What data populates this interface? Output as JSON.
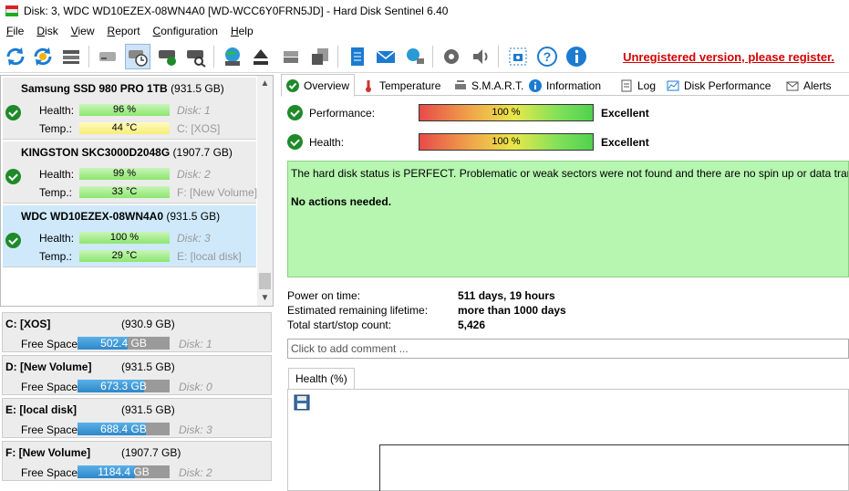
{
  "window": {
    "title": "Disk: 3, WDC WD10EZEX-08WN4A0 [WD-WCC6Y0FRN5JD]  -  Hard Disk Sentinel 6.40"
  },
  "menu": [
    {
      "label": "File",
      "underline": "F",
      "rest": "ile"
    },
    {
      "label": "Disk",
      "underline": "D",
      "rest": "isk"
    },
    {
      "label": "View",
      "underline": "V",
      "rest": "iew"
    },
    {
      "label": "Report",
      "underline": "R",
      "rest": "eport"
    },
    {
      "label": "Configuration",
      "underline": "C",
      "rest": "onfiguration"
    },
    {
      "label": "Help",
      "underline": "H",
      "rest": "elp"
    }
  ],
  "toolbar": {
    "unregistered_text": "Unregistered version, please register."
  },
  "disks": [
    {
      "name": "Samsung SSD 980 PRO 1TB",
      "size": "(931.5 GB)",
      "health_label": "Health:",
      "health": "96 %",
      "temp_label": "Temp.:",
      "temp": "44 °C",
      "disk": "Disk: 1",
      "volume": "C: [XOS]",
      "selected": false,
      "temp_color": "yellow"
    },
    {
      "name": "KINGSTON SKC3000D2048G",
      "size": "(1907.7 GB)",
      "health_label": "Health:",
      "health": "99 %",
      "temp_label": "Temp.:",
      "temp": "33 °C",
      "disk": "Disk: 2",
      "volume": "F: [New Volume]",
      "selected": false,
      "temp_color": "green"
    },
    {
      "name": "WDC WD10EZEX-08WN4A0",
      "size": "(931.5 GB)",
      "health_label": "Health:",
      "health": "100 %",
      "temp_label": "Temp.:",
      "temp": "29 °C",
      "disk": "Disk: 3",
      "volume": "E: [local disk]",
      "selected": true,
      "temp_color": "green"
    }
  ],
  "volumes": [
    {
      "name": "C: [XOS]",
      "size": "(930.9 GB)",
      "free_label": "Free Space",
      "free": "502.4 GB",
      "free_fraction": 0.54,
      "disk": "Disk: 1"
    },
    {
      "name": "D: [New Volume]",
      "size": "(931.5 GB)",
      "free_label": "Free Space",
      "free": "673.3 GB",
      "free_fraction": 0.72,
      "disk": "Disk: 0"
    },
    {
      "name": "E: [local disk]",
      "size": "(931.5 GB)",
      "free_label": "Free Space",
      "free": "688.4 GB",
      "free_fraction": 0.74,
      "disk": "Disk: 3"
    },
    {
      "name": "F: [New Volume]",
      "size": "(1907.7 GB)",
      "free_label": "Free Space",
      "free": "1184.4 GB",
      "free_fraction": 0.62,
      "disk": "Disk: 2"
    }
  ],
  "tabs": [
    "Overview",
    "Temperature",
    "S.M.A.R.T.",
    "Information",
    "Log",
    "Disk Performance",
    "Alerts"
  ],
  "overview": {
    "performance_label": "Performance:",
    "performance_value": "100 %",
    "performance_rating": "Excellent",
    "health_label": "Health:",
    "health_value": "100 %",
    "health_rating": "Excellent",
    "status_text": "The hard disk status is PERFECT. Problematic or weak sectors were not found and there are no spin up or data transfer errors.",
    "action_text": "No actions needed.",
    "power_on_label": "Power on time:",
    "power_on_value": "511 days, 19 hours",
    "lifetime_label": "Estimated remaining lifetime:",
    "lifetime_value": "more than 1000 days",
    "startstop_label": "Total start/stop count:",
    "startstop_value": "5,426",
    "comment_placeholder": "Click to add comment ...",
    "graph_tab": "Health (%)"
  }
}
